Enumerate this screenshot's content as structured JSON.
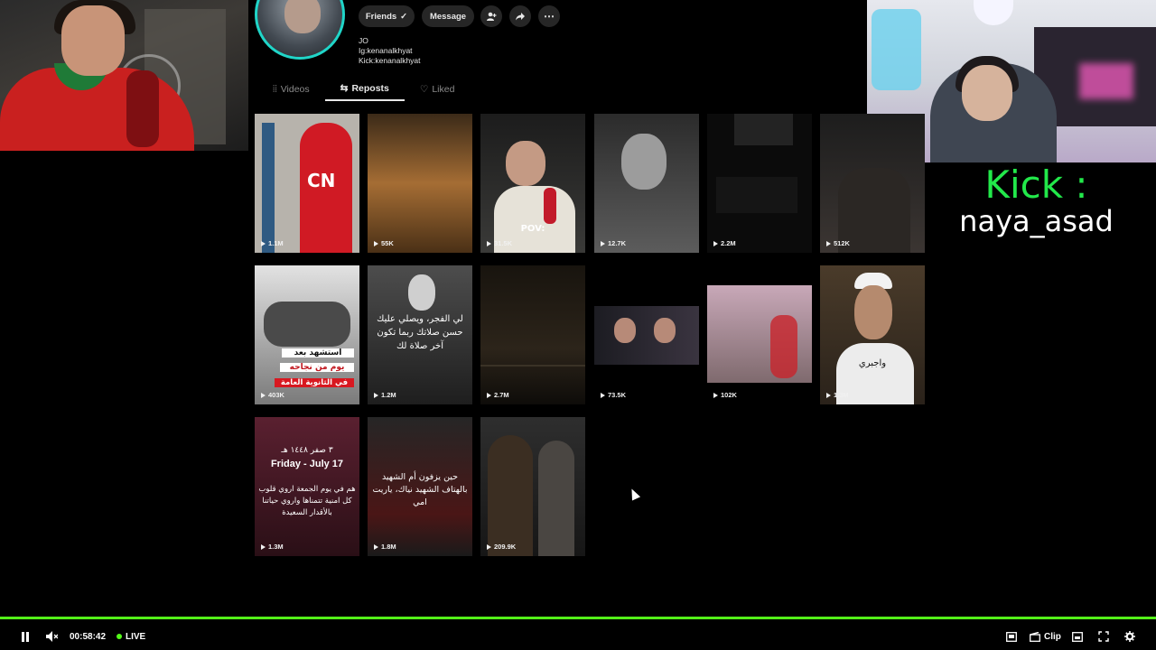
{
  "profile": {
    "bio_lines": [
      "JO",
      "Ig:kenanalkhyat",
      "Kick:kenanalkhyat"
    ],
    "buttons": {
      "friends": "Friends",
      "message": "Message"
    }
  },
  "tabs": [
    {
      "label": "Videos",
      "icon": "grid-icon",
      "active": false
    },
    {
      "label": "Reposts",
      "icon": "repost-icon",
      "active": true
    },
    {
      "label": "Liked",
      "icon": "heart-icon",
      "active": false
    }
  ],
  "videos": [
    {
      "views": "1.1M"
    },
    {
      "views": "55K"
    },
    {
      "views": "31.5K"
    },
    {
      "views": "12.7K"
    },
    {
      "views": "2.2M"
    },
    {
      "views": "512K"
    },
    {
      "views": "403K"
    },
    {
      "views": "1.2M"
    },
    {
      "views": "2.7M"
    },
    {
      "views": "73.5K"
    },
    {
      "views": "102K"
    },
    {
      "views": "1.3M"
    },
    {
      "views": "1.3M"
    },
    {
      "views": "1.8M"
    },
    {
      "views": "209.9K"
    }
  ],
  "captions": {
    "v1": "CN",
    "v3": "POV:",
    "v7a": "استشهد بعد",
    "v7b": "يوم من نجاحه",
    "v7c": "في الثانوية العامة",
    "v8": "لي الفجر، ويصلي عليك حسن صلاتك ربما تكون آخر صلاة لك",
    "v12": "واجبري",
    "v13a": "٣ صفر ١٤٤٨ هـ",
    "v13b": "Friday - July 17",
    "v13c": "هم في يوم الجمعة اروي قلوب كل امنية تتمناها واروي حياتنا بالأقدار السعيدة",
    "v14": "حين يزفون أم الشهيد بالهتاف الشهيد نياك، ياريت امي"
  },
  "overlay": {
    "kick_title": "Kick :",
    "kick_user": "naya_asad"
  },
  "player": {
    "time": "00:58:42",
    "live_label": "LIVE",
    "clip_label": "Clip",
    "progress": 1.0
  },
  "colors": {
    "kick_green": "#53fc18",
    "avatar_ring": "#20d5c8"
  }
}
